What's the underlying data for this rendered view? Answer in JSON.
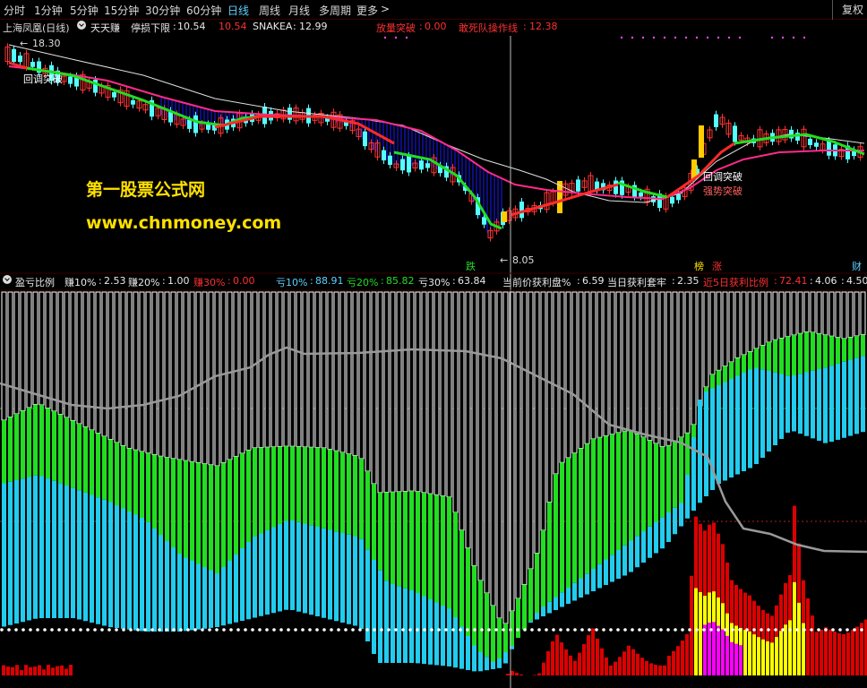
{
  "toolbar": {
    "periods": [
      "分时",
      "1分钟",
      "5分钟",
      "15分钟",
      "30分钟",
      "60分钟",
      "日线",
      "周线",
      "月线",
      "多周期",
      "更多"
    ],
    "active": "日线",
    "fuquan": "复权"
  },
  "main_legend": {
    "title": "上海凤凰(日线)",
    "indicator": "天天赚",
    "stop_label": "停损下限",
    "stop_value": "10.54",
    "stop_value2": "10.54",
    "snakea_label": "SNAKEA",
    "snakea_value": "12.99",
    "vol_label": "放量突破",
    "vol_value": "0.00",
    "dare_label": "敢死队操作线",
    "dare_value": "12.38"
  },
  "annotations": {
    "high_price": "18.30",
    "low_price": "8.05",
    "watermark_cn": "第一股票公式网",
    "watermark_url": "www.chnmoney.com",
    "breakout_a": "回调突破",
    "breakout_b": "回调突破",
    "strong_break": "强势突破",
    "down_label": "跌",
    "up_label": "涨",
    "list_label": "榜",
    "fin_label": "财"
  },
  "sub_legend": {
    "title": "盈亏比例",
    "earn10_label": "赚10%",
    "earn10": "2.53",
    "earn20_label": "赚20%",
    "earn20": "1.00",
    "earn30_label": "赚30%",
    "earn30": "0.00",
    "loss10_label": "亏10%",
    "loss10": "88.91",
    "loss20_label": "亏20%",
    "loss20": "85.82",
    "loss30_label": "亏30%",
    "loss30": "63.84",
    "cur_label": "当前价获利盘%",
    "cur": "6.59",
    "trap_label": "当日获利套牢",
    "trap": "2.35",
    "near5_label": "近5日获利比例",
    "near5": "72.41",
    "extra1": "4.06",
    "extra2": "4.50"
  },
  "colors": {
    "up": "#ff3333",
    "down": "#54ffff",
    "ma_red": "#ff2a2a",
    "ma_green": "#22dd22",
    "ma_mag": "#ff2a8a",
    "blue_fill": "#1a1aff",
    "watermark": "#ffe000",
    "cyan_bar": "#22ccee",
    "green_bar": "#22dd22",
    "gray_line": "#999999",
    "red_bar": "#dd0000",
    "yellow_bar": "#ffff00",
    "magenta_bar": "#ff00ff"
  }
}
